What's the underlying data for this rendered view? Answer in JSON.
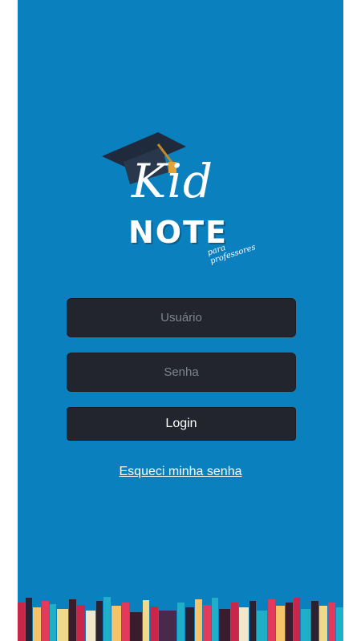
{
  "logo": {
    "line1": "Kid",
    "line2": "NOTE",
    "tagline": "para professores"
  },
  "form": {
    "username_placeholder": "Usuário",
    "password_placeholder": "Senha",
    "login_label": "Login",
    "forgot_link": "Esqueci minha senha"
  },
  "colors": {
    "background": "#0a80be",
    "field": "#22252d",
    "text": "#ffffff"
  }
}
